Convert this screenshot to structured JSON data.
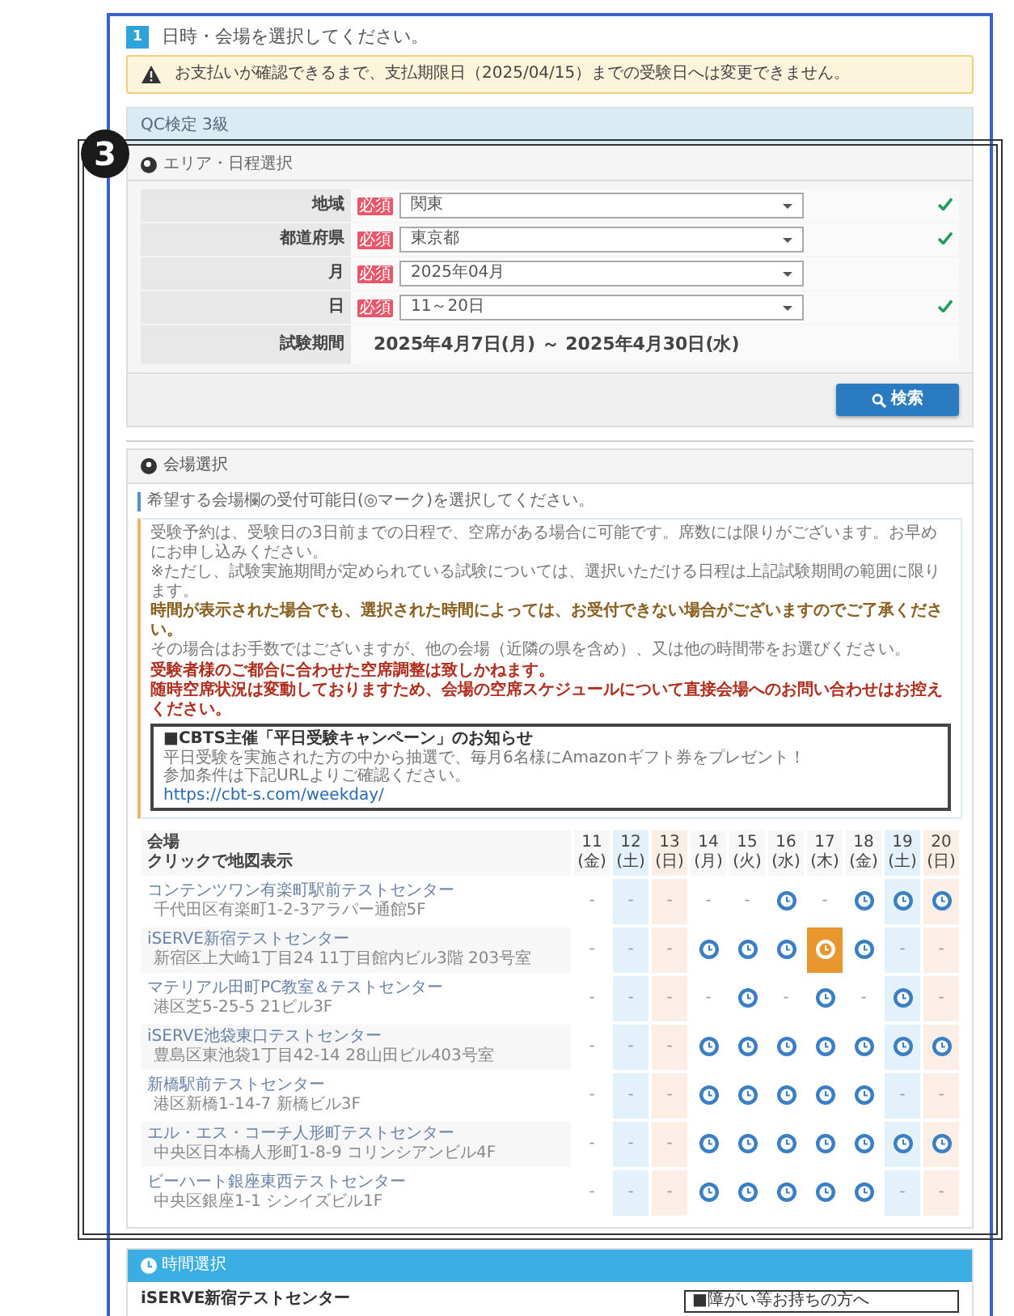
{
  "annotation": {
    "label": "3"
  },
  "title": {
    "step": "1",
    "text": "日時・会場を選択してください。"
  },
  "alert": {
    "text": "お支払いが確認できるまで、支払期限日（2025/04/15）までの受験日へは変更できません。"
  },
  "exam_panel": {
    "title": "QC検定 3級",
    "section": "エリア・日程選択",
    "fields": [
      {
        "label": "地域",
        "badge": "必須",
        "value": "関東",
        "valid": true
      },
      {
        "label": "都道府県",
        "badge": "必須",
        "value": "東京都",
        "valid": true
      },
      {
        "label": "月",
        "badge": "必須",
        "value": "2025年04月",
        "valid": false
      },
      {
        "label": "日",
        "badge": "必須",
        "value": "11～20日",
        "valid": true
      }
    ],
    "period": {
      "label": "試験期間",
      "value": "2025年4月7日(月) ～ 2025年4月30日(水)"
    },
    "search_button": "検索"
  },
  "venue_section": {
    "title": "会場選択",
    "instruction": "希望する会場欄の受付可能日(◎マーク)を選択してください。",
    "notices": [
      {
        "kind": "normal",
        "text": "受験予約は、受験日の3日前までの日程で、空席がある場合に可能です。席数には限りがございます。お早めにお申し込みください。"
      },
      {
        "kind": "normal",
        "text": "※ただし、試験実施期間が定められている試験については、選択いただける日程は上記試験期間の範囲に限ります。"
      },
      {
        "kind": "warning",
        "text": "時間が表示された場合でも、選択された時間によっては、お受付できない場合がございますのでご了承ください。"
      },
      {
        "kind": "normal",
        "text": "その場合はお手数ではございますが、他の会場（近隣の県を含め）、又は他の時間帯をお選びください。"
      },
      {
        "kind": "danger",
        "text": "受験者様のご都合に合わせた空席調整は致しかねます。"
      },
      {
        "kind": "danger",
        "text": "随時空席状況は変動しておりますため、会場の空席スケジュールについて直接会場へのお問い合わせはお控えください。"
      }
    ],
    "campaign": {
      "title": "■CBTS主催「平日受験キャンペーン」のお知らせ",
      "lines": [
        "平日受験を実施された方の中から抽選で、毎月6名様にAmazonギフト券をプレゼント！",
        "参加条件は下記URLよりご確認ください。"
      ],
      "link": "https://cbt-s.com/weekday/"
    }
  },
  "table": {
    "venue_header": "会場",
    "venue_hint": "クリックで地図表示",
    "days": [
      {
        "date": "11",
        "weekday": "(金)",
        "kind": "weekday"
      },
      {
        "date": "12",
        "weekday": "(土)",
        "kind": "sat"
      },
      {
        "date": "13",
        "weekday": "(日)",
        "kind": "sun"
      },
      {
        "date": "14",
        "weekday": "(月)",
        "kind": "weekday"
      },
      {
        "date": "15",
        "weekday": "(火)",
        "kind": "weekday"
      },
      {
        "date": "16",
        "weekday": "(水)",
        "kind": "weekday"
      },
      {
        "date": "17",
        "weekday": "(木)",
        "kind": "weekday"
      },
      {
        "date": "18",
        "weekday": "(金)",
        "kind": "weekday"
      },
      {
        "date": "19",
        "weekday": "(土)",
        "kind": "sat"
      },
      {
        "date": "20",
        "weekday": "(日)",
        "kind": "sun"
      }
    ],
    "rows": [
      {
        "name": "コンテンツワン有楽町駅前テストセンター",
        "address": "千代田区有楽町1-2-3アラパー通館5F",
        "slots": [
          {
            "kind": "none",
            "text": "-",
            "selected": false
          },
          {
            "kind": "none",
            "text": "-",
            "selected": false
          },
          {
            "kind": "none",
            "text": "-",
            "selected": false
          },
          {
            "kind": "none",
            "text": "-",
            "selected": false
          },
          {
            "kind": "none",
            "text": "-",
            "selected": false
          },
          {
            "kind": "open",
            "selected": false
          },
          {
            "kind": "none",
            "text": "-",
            "selected": false
          },
          {
            "kind": "open",
            "selected": false
          },
          {
            "kind": "open",
            "selected": false
          },
          {
            "kind": "open",
            "selected": false
          }
        ]
      },
      {
        "name": "iSERVE新宿テストセンター",
        "address": "新宿区上大崎1丁目24 11丁目館内ビル3階 203号室",
        "slots": [
          {
            "kind": "none",
            "text": "-",
            "selected": false
          },
          {
            "kind": "none",
            "text": "-",
            "selected": false
          },
          {
            "kind": "none",
            "text": "-",
            "selected": false
          },
          {
            "kind": "open",
            "selected": false
          },
          {
            "kind": "open",
            "selected": false
          },
          {
            "kind": "open",
            "selected": false
          },
          {
            "kind": "open",
            "selected": true
          },
          {
            "kind": "open",
            "selected": false
          },
          {
            "kind": "none",
            "text": "-",
            "selected": false
          },
          {
            "kind": "none",
            "text": "-",
            "selected": false
          }
        ]
      },
      {
        "name": "マテリアル田町PC教室＆テストセンター",
        "address": "港区芝5-25-5 21ビル3F",
        "slots": [
          {
            "kind": "none",
            "text": "-",
            "selected": false
          },
          {
            "kind": "none",
            "text": "-",
            "selected": false
          },
          {
            "kind": "none",
            "text": "-",
            "selected": false
          },
          {
            "kind": "none",
            "text": "-",
            "selected": false
          },
          {
            "kind": "open",
            "selected": false
          },
          {
            "kind": "none",
            "text": "-",
            "selected": false
          },
          {
            "kind": "open",
            "selected": false
          },
          {
            "kind": "none",
            "text": "-",
            "selected": false
          },
          {
            "kind": "open",
            "selected": false
          },
          {
            "kind": "none",
            "text": "-",
            "selected": false
          }
        ]
      },
      {
        "name": "iSERVE池袋東口テストセンター",
        "address": "豊島区東池袋1丁目42-14 28山田ビル403号室",
        "slots": [
          {
            "kind": "none",
            "text": "-",
            "selected": false
          },
          {
            "kind": "none",
            "text": "-",
            "selected": false
          },
          {
            "kind": "none",
            "text": "-",
            "selected": false
          },
          {
            "kind": "open",
            "selected": false
          },
          {
            "kind": "open",
            "selected": false
          },
          {
            "kind": "open",
            "selected": false
          },
          {
            "kind": "open",
            "selected": false
          },
          {
            "kind": "open",
            "selected": false
          },
          {
            "kind": "open",
            "selected": false
          },
          {
            "kind": "open",
            "selected": false
          }
        ]
      },
      {
        "name": "新橋駅前テストセンター",
        "address": "港区新橋1-14-7 新橋ビル3F",
        "slots": [
          {
            "kind": "none",
            "text": "-",
            "selected": false
          },
          {
            "kind": "none",
            "text": "-",
            "selected": false
          },
          {
            "kind": "none",
            "text": "-",
            "selected": false
          },
          {
            "kind": "open",
            "selected": false
          },
          {
            "kind": "open",
            "selected": false
          },
          {
            "kind": "open",
            "selected": false
          },
          {
            "kind": "open",
            "selected": false
          },
          {
            "kind": "open",
            "selected": false
          },
          {
            "kind": "none",
            "text": "-",
            "selected": false
          },
          {
            "kind": "none",
            "text": "-",
            "selected": false
          }
        ]
      },
      {
        "name": "エル・エス・コーチ人形町テストセンター",
        "address": "中央区日本橋人形町1-8-9 コリンシアンビル4F",
        "slots": [
          {
            "kind": "none",
            "text": "-",
            "selected": false
          },
          {
            "kind": "none",
            "text": "-",
            "selected": false
          },
          {
            "kind": "none",
            "text": "-",
            "selected": false
          },
          {
            "kind": "open",
            "selected": false
          },
          {
            "kind": "open",
            "selected": false
          },
          {
            "kind": "open",
            "selected": false
          },
          {
            "kind": "open",
            "selected": false
          },
          {
            "kind": "open",
            "selected": false
          },
          {
            "kind": "open",
            "selected": false
          },
          {
            "kind": "open",
            "selected": false
          }
        ]
      },
      {
        "name": "ビーハート銀座東西テストセンター",
        "address": "中央区銀座1-1 シンイズビル1F",
        "slots": [
          {
            "kind": "none",
            "text": "-",
            "selected": false
          },
          {
            "kind": "none",
            "text": "-",
            "selected": false
          },
          {
            "kind": "none",
            "text": "-",
            "selected": false
          },
          {
            "kind": "open",
            "selected": false
          },
          {
            "kind": "open",
            "selected": false
          },
          {
            "kind": "open",
            "selected": false
          },
          {
            "kind": "open",
            "selected": false
          },
          {
            "kind": "open",
            "selected": false
          },
          {
            "kind": "none",
            "text": "-",
            "selected": false
          },
          {
            "kind": "none",
            "text": "-",
            "selected": false
          }
        ]
      }
    ]
  },
  "time_section": {
    "title": "時間選択",
    "venue": "iSERVE新宿テストセンター",
    "note": "■障がい等お持ちの方へ"
  }
}
